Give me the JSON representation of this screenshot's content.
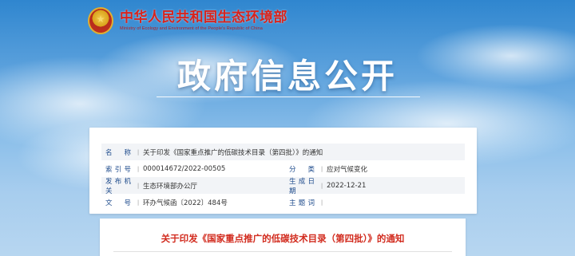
{
  "header": {
    "org_cn": "中华人民共和国生态环境部",
    "org_en": "Ministry of Ecology and Environment of the People's Republic of China"
  },
  "banner": {
    "title": "政府信息公开"
  },
  "info": {
    "name_label": "名    称",
    "name_value": "关于印发《国家重点推广的低碳技术目录（第四批）》的通知",
    "index_label": "索 引 号",
    "index_value": "000014672/2022-00505",
    "category_label": "分    类",
    "category_value": "应对气候变化",
    "issuer_label": "发布机关",
    "issuer_value": "生态环境部办公厅",
    "date_label": "生成日期",
    "date_value": "2022-12-21",
    "doc_no_label": "文    号",
    "doc_no_value": "环办气候函〔2022〕484号",
    "subject_label": "主 题 词",
    "subject_value": ""
  },
  "document": {
    "title": "关于印发《国家重点推广的低碳技术目录（第四批）》的通知"
  },
  "colors": {
    "accent_red": "#d22c1f",
    "label_blue": "#1e4b8c"
  }
}
